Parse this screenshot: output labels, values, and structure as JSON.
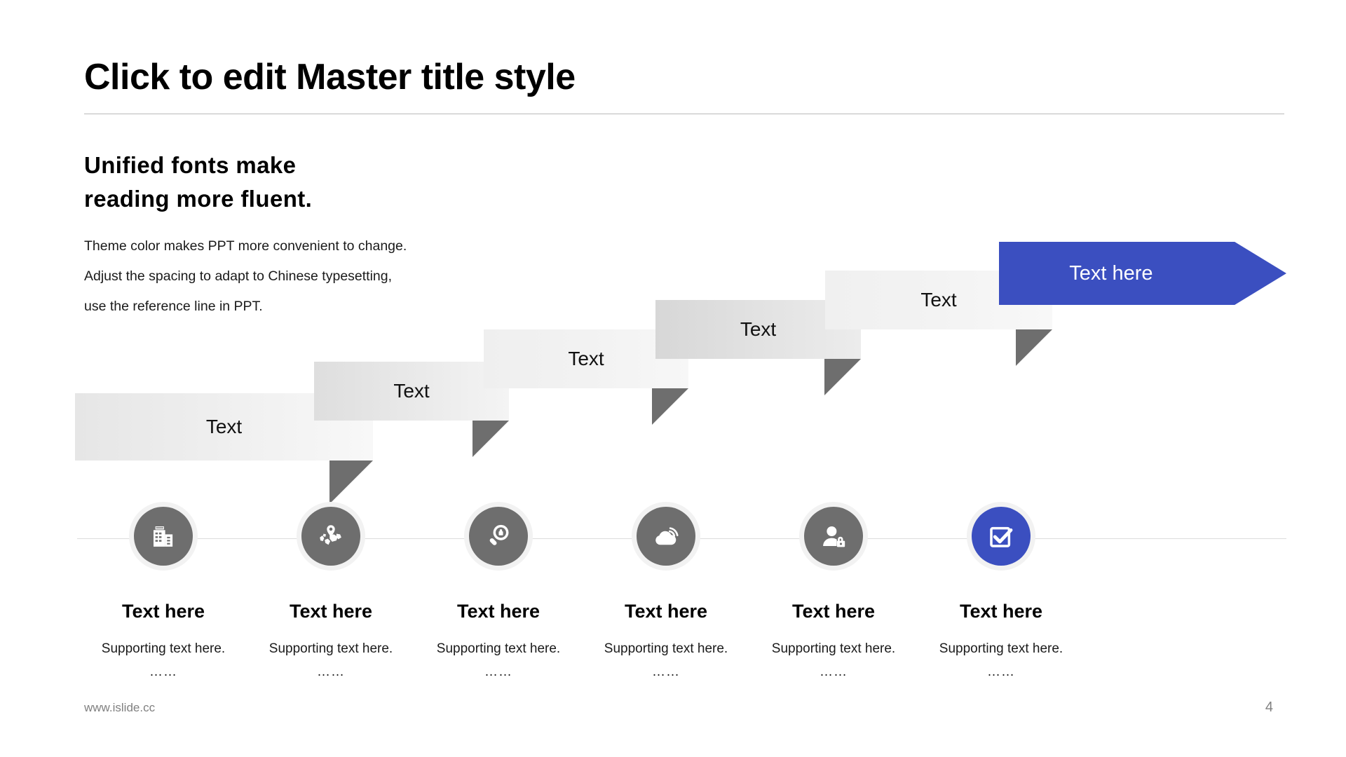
{
  "slide": {
    "title": "Click to edit Master title style",
    "lead_heading_line1": "Unified fonts make",
    "lead_heading_line2": "reading more fluent.",
    "body_line1": "Theme color makes PPT more convenient to change.",
    "body_line2": "Adjust the spacing to adapt to Chinese typesetting,",
    "body_line3": "use the reference line in PPT.",
    "accent_color": "#3b4fc0",
    "ribbon_gray": "#e9e9e9",
    "fold_gray": "#6e6e6e"
  },
  "ribbons": [
    {
      "label": "Text",
      "style": "gray1"
    },
    {
      "label": "Text",
      "style": "gray2"
    },
    {
      "label": "Text",
      "style": "gray3"
    },
    {
      "label": "Text",
      "style": "gray4"
    },
    {
      "label": "Text",
      "style": "gray5"
    },
    {
      "label": "Text here",
      "style": "accent"
    }
  ],
  "steps": [
    {
      "icon": "office-building-icon",
      "title": "Text here",
      "subtitle": "Supporting text here.",
      "dots": "……"
    },
    {
      "icon": "world-map-pin-icon",
      "title": "Text here",
      "subtitle": "Supporting text here.",
      "dots": "……"
    },
    {
      "icon": "magnifier-lock-icon",
      "title": "Text here",
      "subtitle": "Supporting text here.",
      "dots": "……"
    },
    {
      "icon": "cloud-signal-icon",
      "title": "Text here",
      "subtitle": "Supporting text here.",
      "dots": "……"
    },
    {
      "icon": "user-lock-icon",
      "title": "Text here",
      "subtitle": "Supporting text here.",
      "dots": "……"
    },
    {
      "icon": "checkbox-check-icon",
      "title": "Text here",
      "subtitle": "Supporting text here.",
      "dots": "……"
    }
  ],
  "footer": {
    "url": "www.islide.cc",
    "page_number": "4"
  }
}
